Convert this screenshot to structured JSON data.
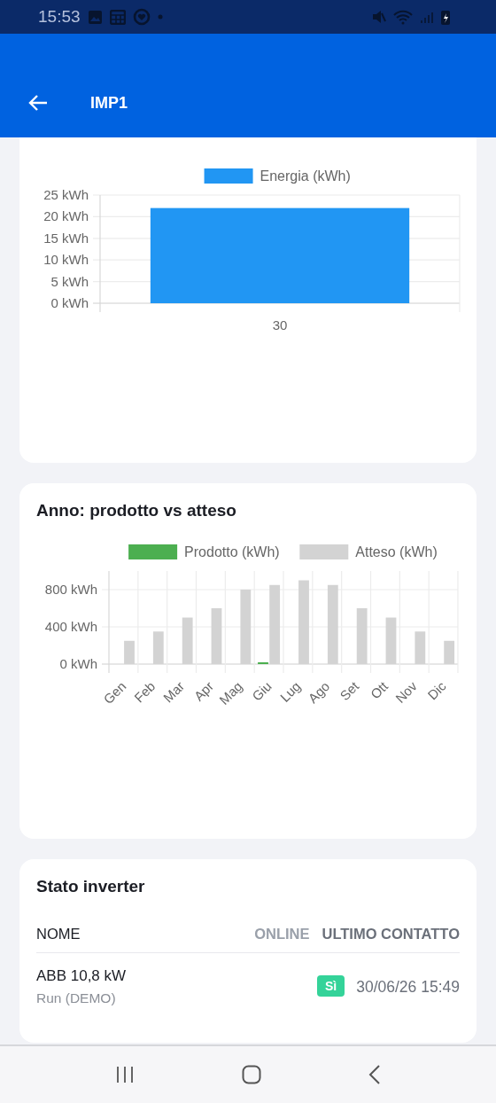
{
  "status_bar": {
    "time": "15:53"
  },
  "app_bar": {
    "title": "IMP1"
  },
  "month_card": {
    "chart_data": {
      "type": "bar",
      "categories": [
        "30"
      ],
      "series": [
        {
          "name": "Energia (kWh)",
          "color": "#2196f3",
          "values": [
            22
          ]
        }
      ],
      "ylim": [
        0,
        25
      ],
      "yticks": [
        {
          "value": 0,
          "label": "0 kWh"
        },
        {
          "value": 5,
          "label": "5 kWh"
        },
        {
          "value": 10,
          "label": "10 kWh"
        },
        {
          "value": 15,
          "label": "15 kWh"
        },
        {
          "value": 20,
          "label": "20 kWh"
        },
        {
          "value": 25,
          "label": "25 kWh"
        }
      ],
      "grid": true,
      "legend": true
    }
  },
  "year_card": {
    "title": "Anno: prodotto vs atteso",
    "chart_data": {
      "type": "bar",
      "categories": [
        "Gen",
        "Feb",
        "Mar",
        "Apr",
        "Mag",
        "Giu",
        "Lug",
        "Ago",
        "Set",
        "Ott",
        "Nov",
        "Dic"
      ],
      "series": [
        {
          "name": "Prodotto (kWh)",
          "color": "#4caf50",
          "values": [
            null,
            null,
            null,
            null,
            null,
            20,
            null,
            null,
            null,
            null,
            null,
            null
          ]
        },
        {
          "name": "Atteso (kWh)",
          "color": "#d3d3d3",
          "values": [
            250,
            350,
            500,
            600,
            800,
            850,
            900,
            850,
            600,
            500,
            350,
            250
          ]
        }
      ],
      "ylim": [
        0,
        1000
      ],
      "yticks": [
        {
          "value": 0,
          "label": "0 kWh"
        },
        {
          "value": 400,
          "label": "400 kWh"
        },
        {
          "value": 800,
          "label": "800 kWh"
        }
      ],
      "grid": true,
      "legend": true
    }
  },
  "inverter_card": {
    "title": "Stato inverter",
    "columns": [
      "NOME",
      "ONLINE",
      "ULTIMO CONTATTO"
    ],
    "rows": [
      {
        "name": "ABB 10,8 kW",
        "status": "Run (DEMO)",
        "online": true,
        "online_label": "Sì",
        "last_contact": "30/06/26 15:49"
      }
    ]
  }
}
